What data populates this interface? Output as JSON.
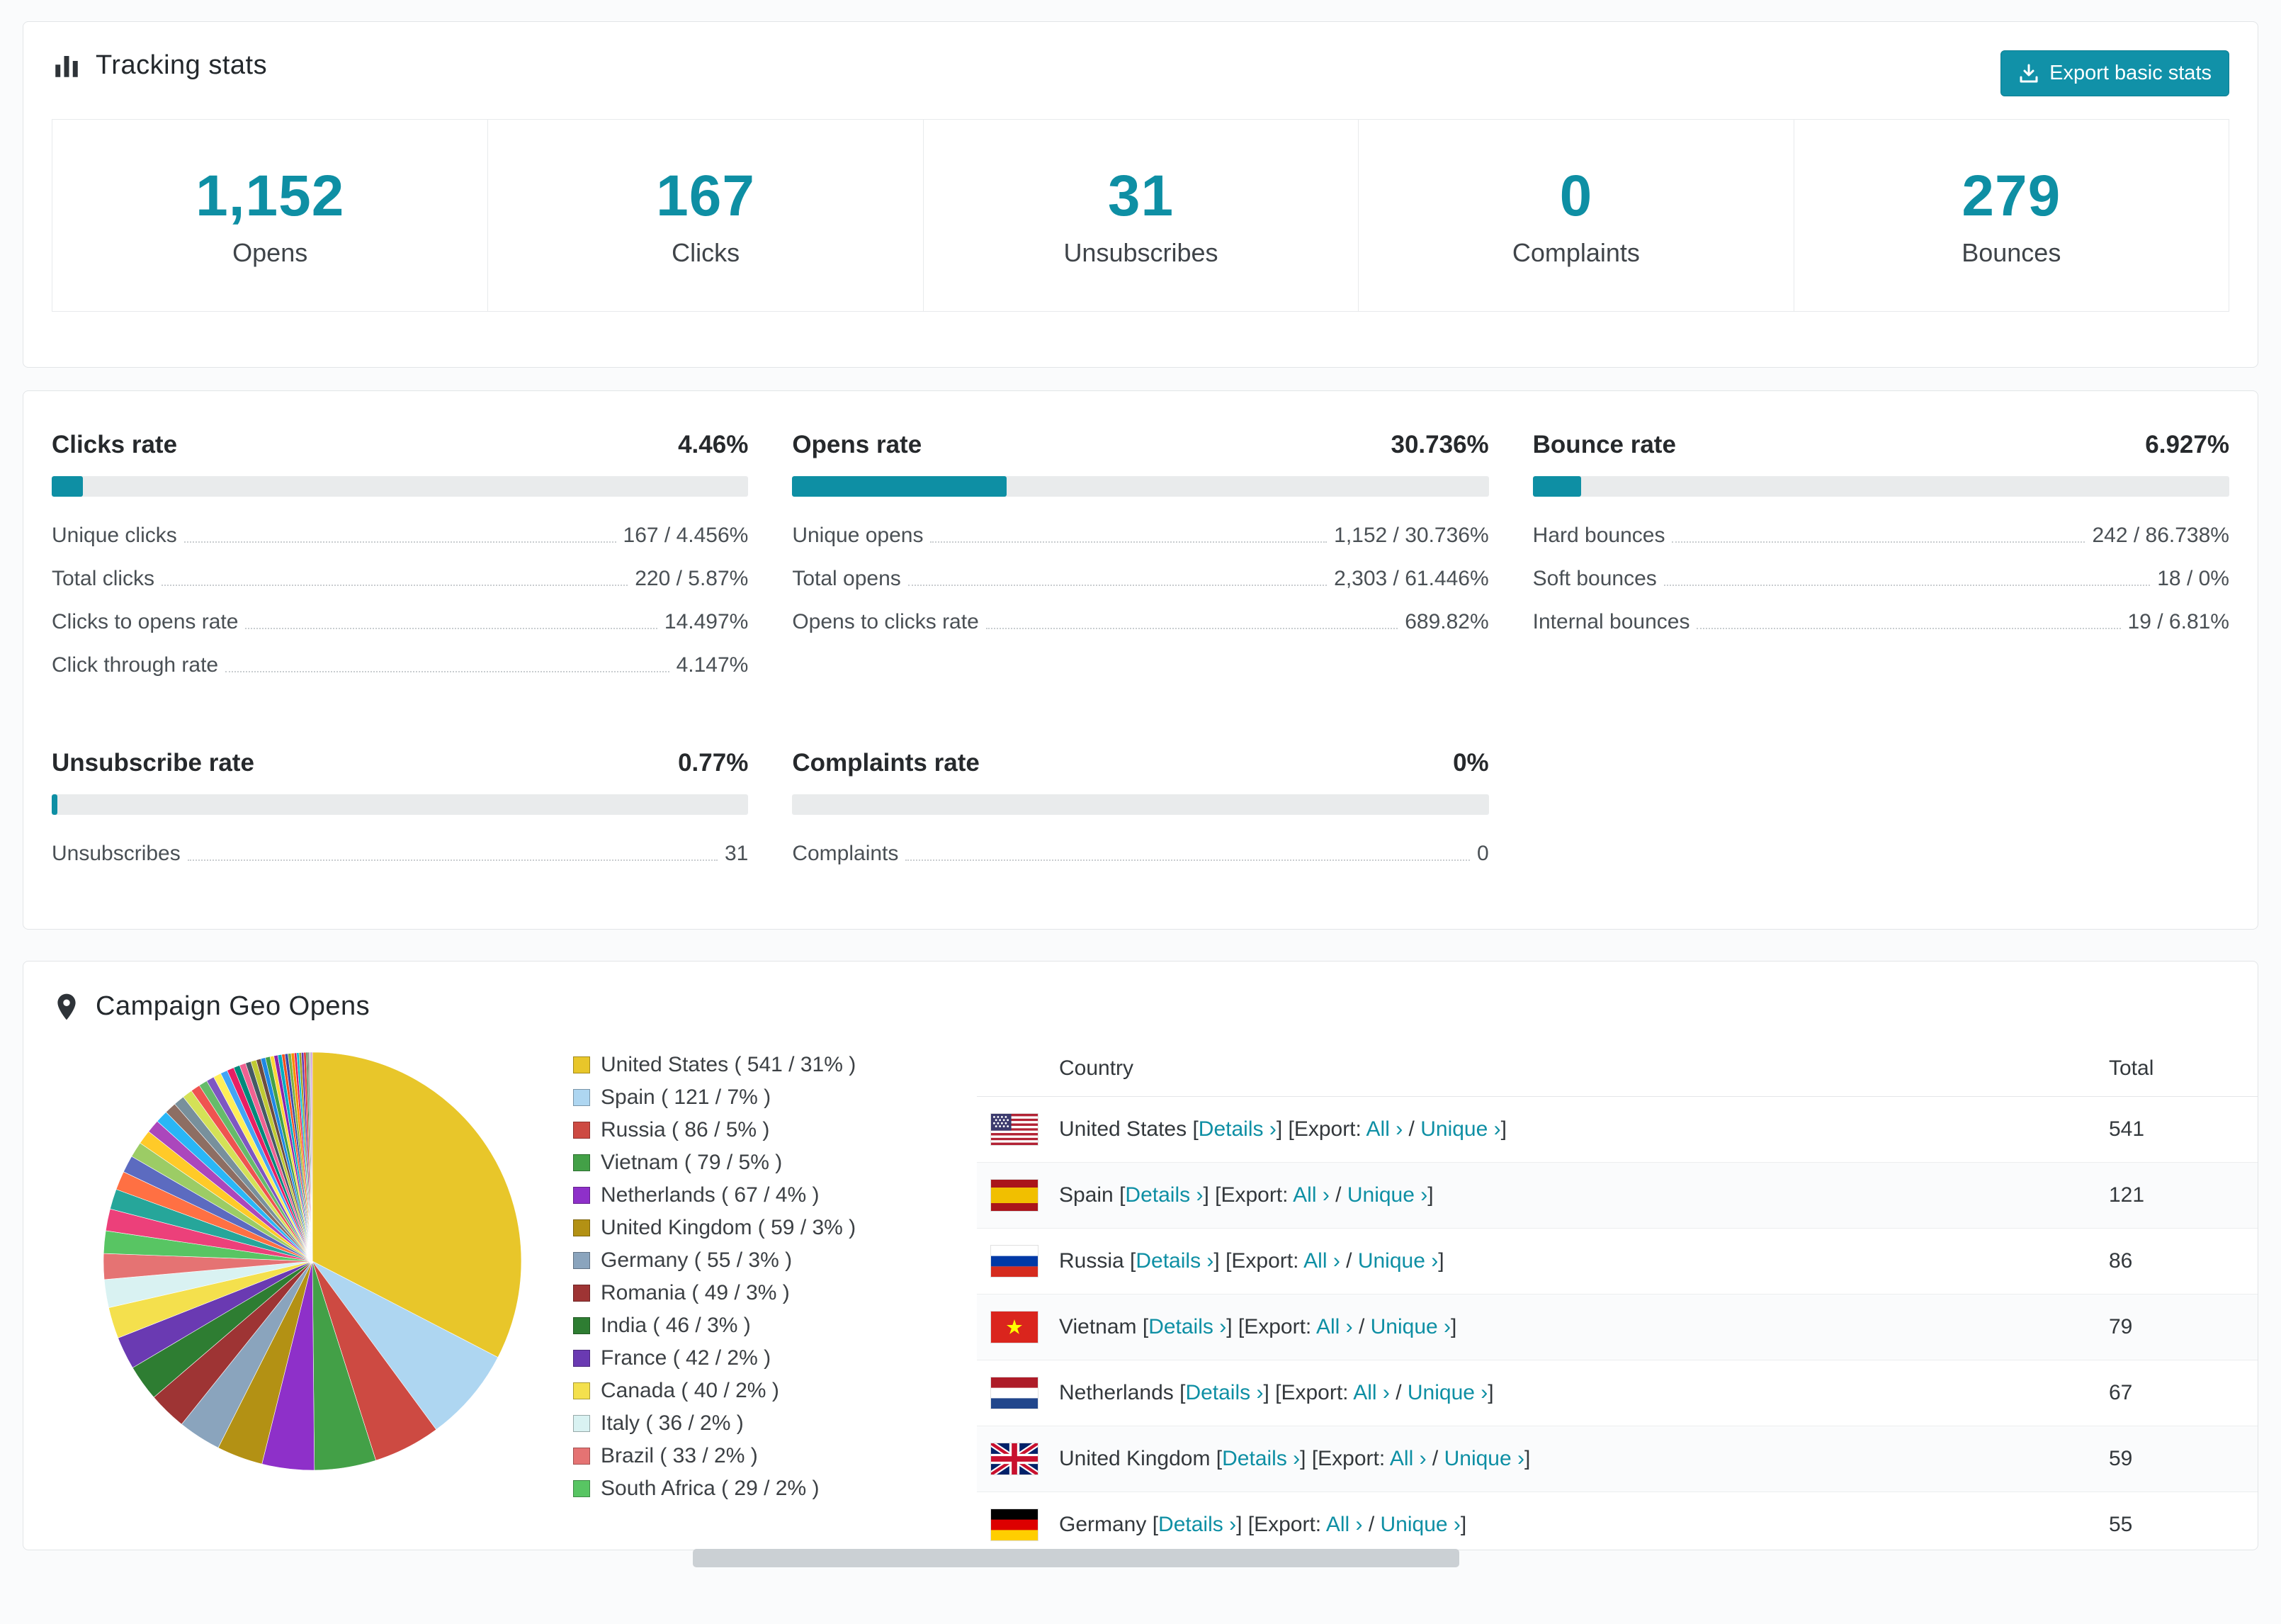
{
  "accent": "#0e8fa4",
  "tracking": {
    "title": "Tracking stats",
    "export_button": "Export basic stats",
    "stats": [
      {
        "value": "1,152",
        "label": "Opens"
      },
      {
        "value": "167",
        "label": "Clicks"
      },
      {
        "value": "31",
        "label": "Unsubscribes"
      },
      {
        "value": "0",
        "label": "Complaints"
      },
      {
        "value": "279",
        "label": "Bounces"
      }
    ]
  },
  "rates": [
    {
      "title": "Clicks rate",
      "value": "4.46%",
      "pct": 4.46,
      "rows": [
        [
          "Unique clicks",
          "167 / 4.456%"
        ],
        [
          "Total clicks",
          "220 / 5.87%"
        ],
        [
          "Clicks to opens rate",
          "14.497%"
        ],
        [
          "Click through rate",
          "4.147%"
        ]
      ]
    },
    {
      "title": "Opens rate",
      "value": "30.736%",
      "pct": 30.736,
      "rows": [
        [
          "Unique opens",
          "1,152 / 30.736%"
        ],
        [
          "Total opens",
          "2,303 / 61.446%"
        ],
        [
          "Opens to clicks rate",
          "689.82%"
        ]
      ]
    },
    {
      "title": "Bounce rate",
      "value": "6.927%",
      "pct": 6.927,
      "rows": [
        [
          "Hard bounces",
          "242 / 86.738%"
        ],
        [
          "Soft bounces",
          "18 / 0%"
        ],
        [
          "Internal bounces",
          "19 / 6.81%"
        ]
      ]
    },
    {
      "title": "Unsubscribe rate",
      "value": "0.77%",
      "pct": 0.77,
      "rows": [
        [
          "Unsubscribes",
          "31"
        ]
      ]
    },
    {
      "title": "Complaints rate",
      "value": "0%",
      "pct": 0,
      "rows": [
        [
          "Complaints",
          "0"
        ]
      ]
    }
  ],
  "geo": {
    "title": "Campaign Geo Opens",
    "chart_data": {
      "type": "pie",
      "title": "Campaign Geo Opens",
      "legend_position": "right",
      "slices": [
        {
          "name": "United States",
          "value": 541,
          "pct": "31%",
          "color": "#e8c62a",
          "label": "United States ( 541 / 31% )"
        },
        {
          "name": "Spain",
          "value": 121,
          "pct": "7%",
          "color": "#aed6f1",
          "label": "Spain ( 121 / 7% )"
        },
        {
          "name": "Russia",
          "value": 86,
          "pct": "5%",
          "color": "#cd4a42",
          "label": "Russia ( 86 / 5% )"
        },
        {
          "name": "Vietnam",
          "value": 79,
          "pct": "5%",
          "color": "#43a047",
          "label": "Vietnam ( 79 / 5% )"
        },
        {
          "name": "Netherlands",
          "value": 67,
          "pct": "4%",
          "color": "#8e30c9",
          "label": "Netherlands ( 67 / 4% )"
        },
        {
          "name": "United Kingdom",
          "value": 59,
          "pct": "3%",
          "color": "#b39114",
          "label": "United Kingdom ( 59 / 3% )"
        },
        {
          "name": "Germany",
          "value": 55,
          "pct": "3%",
          "color": "#8aa4bd",
          "label": "Germany ( 55 / 3% )"
        },
        {
          "name": "Romania",
          "value": 49,
          "pct": "3%",
          "color": "#9e3434",
          "label": "Romania ( 49 / 3% )"
        },
        {
          "name": "India",
          "value": 46,
          "pct": "3%",
          "color": "#2e7d32",
          "label": "India ( 46 / 3% )"
        },
        {
          "name": "France",
          "value": 42,
          "pct": "2%",
          "color": "#6a3ab2",
          "label": "France ( 42 / 2% )"
        },
        {
          "name": "Canada",
          "value": 40,
          "pct": "2%",
          "color": "#f4e04d",
          "label": "Canada ( 40 / 2% )"
        },
        {
          "name": "Italy",
          "value": 36,
          "pct": "2%",
          "color": "#d9f2f2",
          "label": "Italy ( 36 / 2% )"
        },
        {
          "name": "Brazil",
          "value": 33,
          "pct": "2%",
          "color": "#e57373",
          "label": "Brazil ( 33 / 2% )"
        },
        {
          "name": "South Africa",
          "value": 29,
          "pct": "2%",
          "color": "#58c563",
          "label": "South Africa ( 29 / 2% )"
        }
      ],
      "others": [
        {
          "value": 28,
          "color": "#ec407a"
        },
        {
          "value": 26,
          "color": "#26a69a"
        },
        {
          "value": 24,
          "color": "#ff7043"
        },
        {
          "value": 22,
          "color": "#5c6bc0"
        },
        {
          "value": 20,
          "color": "#9ccc65"
        },
        {
          "value": 18,
          "color": "#ffca28"
        },
        {
          "value": 17,
          "color": "#ab47bc"
        },
        {
          "value": 16,
          "color": "#29b6f6"
        },
        {
          "value": 15,
          "color": "#8d6e63"
        },
        {
          "value": 14,
          "color": "#78909c"
        },
        {
          "value": 13,
          "color": "#d4e157"
        },
        {
          "value": 12,
          "color": "#ef5350"
        },
        {
          "value": 11,
          "color": "#66bb6a"
        },
        {
          "value": 10,
          "color": "#7e57c2"
        },
        {
          "value": 10,
          "color": "#ffee58"
        },
        {
          "value": 9,
          "color": "#42a5f5"
        },
        {
          "value": 9,
          "color": "#e91e63"
        },
        {
          "value": 8,
          "color": "#00897b"
        },
        {
          "value": 8,
          "color": "#f06292"
        },
        {
          "value": 7,
          "color": "#455a64"
        },
        {
          "value": 7,
          "color": "#c0ca33"
        },
        {
          "value": 6,
          "color": "#6d4c41"
        },
        {
          "value": 6,
          "color": "#1e88e5"
        },
        {
          "value": 6,
          "color": "#43a047"
        },
        {
          "value": 5,
          "color": "#fdd835"
        },
        {
          "value": 5,
          "color": "#8e24aa"
        },
        {
          "value": 5,
          "color": "#00acc1"
        },
        {
          "value": 4,
          "color": "#f4511e"
        },
        {
          "value": 4,
          "color": "#3949ab"
        },
        {
          "value": 4,
          "color": "#7cb342"
        },
        {
          "value": 4,
          "color": "#fb8c00"
        },
        {
          "value": 3,
          "color": "#d81b60"
        },
        {
          "value": 3,
          "color": "#00bcd4"
        },
        {
          "value": 3,
          "color": "#9e9d24"
        },
        {
          "value": 3,
          "color": "#5e35b1"
        },
        {
          "value": 3,
          "color": "#e53935"
        },
        {
          "value": 2,
          "color": "#2e7d32"
        },
        {
          "value": 2,
          "color": "#757575"
        },
        {
          "value": 2,
          "color": "#bdbdbd"
        },
        {
          "value": 2,
          "color": "#ce93d8"
        }
      ]
    },
    "table": {
      "headers": [
        "Country",
        "Total"
      ],
      "labels": {
        "bracket_open": "[",
        "bracket_close": "]",
        "details": "Details ›",
        "export_prefix": "Export:",
        "all": "All ›",
        "slash": "/",
        "unique": "Unique ›"
      },
      "rows": [
        {
          "country": "United States",
          "flag": "us",
          "total": "541"
        },
        {
          "country": "Spain",
          "flag": "es",
          "total": "121"
        },
        {
          "country": "Russia",
          "flag": "ru",
          "total": "86"
        },
        {
          "country": "Vietnam",
          "flag": "vn",
          "total": "79"
        },
        {
          "country": "Netherlands",
          "flag": "nl",
          "total": "67"
        },
        {
          "country": "United Kingdom",
          "flag": "gb",
          "total": "59"
        },
        {
          "country": "Germany",
          "flag": "de",
          "total": "55"
        }
      ]
    }
  }
}
